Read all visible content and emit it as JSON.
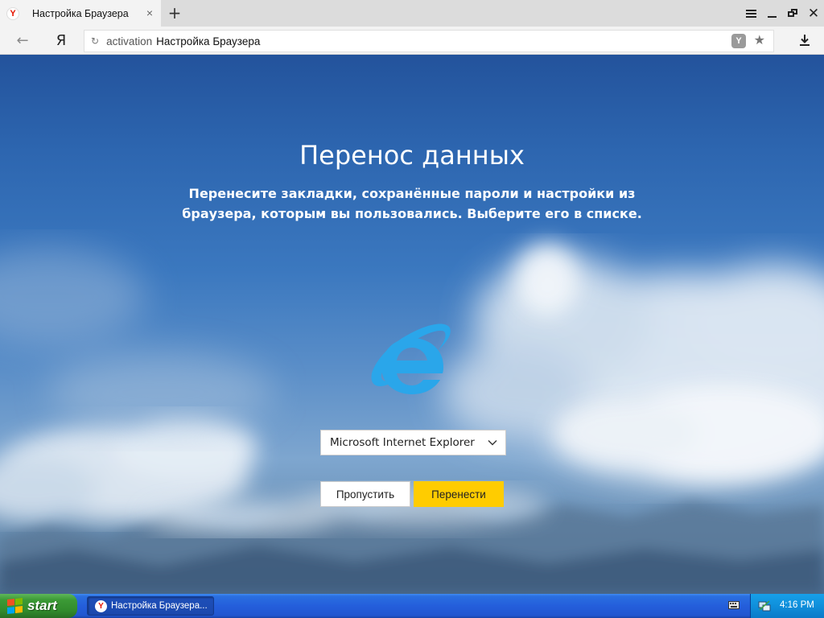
{
  "browser": {
    "tab": {
      "title": "Настройка Браузера",
      "favicon": "Y",
      "close": "×"
    },
    "new_tab": "+",
    "logo_letter": "Я",
    "address": {
      "host": "activation",
      "title": "Настройка Браузера"
    },
    "protect_badge": "Y"
  },
  "page": {
    "title": "Перенос данных",
    "subtitle_line1": "Перенесите закладки, сохранённые пароли и настройки из",
    "subtitle_line2": "браузера, которым вы пользовались. Выберите его в списке.",
    "browser_select": {
      "value": "Microsoft Internet Explorer"
    },
    "skip_label": "Пропустить",
    "transfer_label": "Перенести",
    "colors": {
      "transfer_button": "#ffcc00",
      "ie_logo": "#2aa6ea"
    }
  },
  "taskbar": {
    "start_label": "start",
    "item_label": "Настройка Браузера...",
    "item_favicon": "Y",
    "clock": "4:16 PM"
  },
  "icons": {
    "back": "back-arrow-icon",
    "reload": "reload-icon",
    "star": "star-icon",
    "download": "download-icon",
    "menu": "hamburger-menu-icon",
    "ie": "internet-explorer-icon"
  }
}
